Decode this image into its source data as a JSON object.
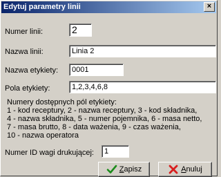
{
  "window": {
    "title": "Edytuj parametry linii",
    "close_glyph": "×"
  },
  "fields": {
    "line_number": {
      "label": "Numer linii:",
      "value": "2"
    },
    "line_name": {
      "label": "Nazwa linii:",
      "value": "Linia 2"
    },
    "label_name": {
      "label": "Nazwa etykiety:",
      "value": "0001"
    },
    "label_fields": {
      "label": "Pola etykiety:",
      "value": "1,2,3,4,6,8"
    },
    "scale_id": {
      "label": "Numer ID wagi drukującej:",
      "value": "1"
    }
  },
  "info_lines": [
    "Numery dostępnych pól etykiety:",
    "1 - kod receptury, 2 - nazwa receptury, 3 - kod składnika,",
    "4 - nazwa składnika, 5 - numer pojemnika, 6 - masa netto,",
    "7 - masa brutto, 8 - data ważenia, 9 - czas ważenia,",
    "10 - nazwa operatora"
  ],
  "buttons": {
    "save": {
      "mnemonic": "Z",
      "rest": "apisz",
      "icon": "checkmark-icon",
      "color": "#1c8c1c"
    },
    "cancel": {
      "mnemonic": "A",
      "rest": "nuluj",
      "icon": "x-cross-icon",
      "color": "#d81e1e"
    }
  }
}
